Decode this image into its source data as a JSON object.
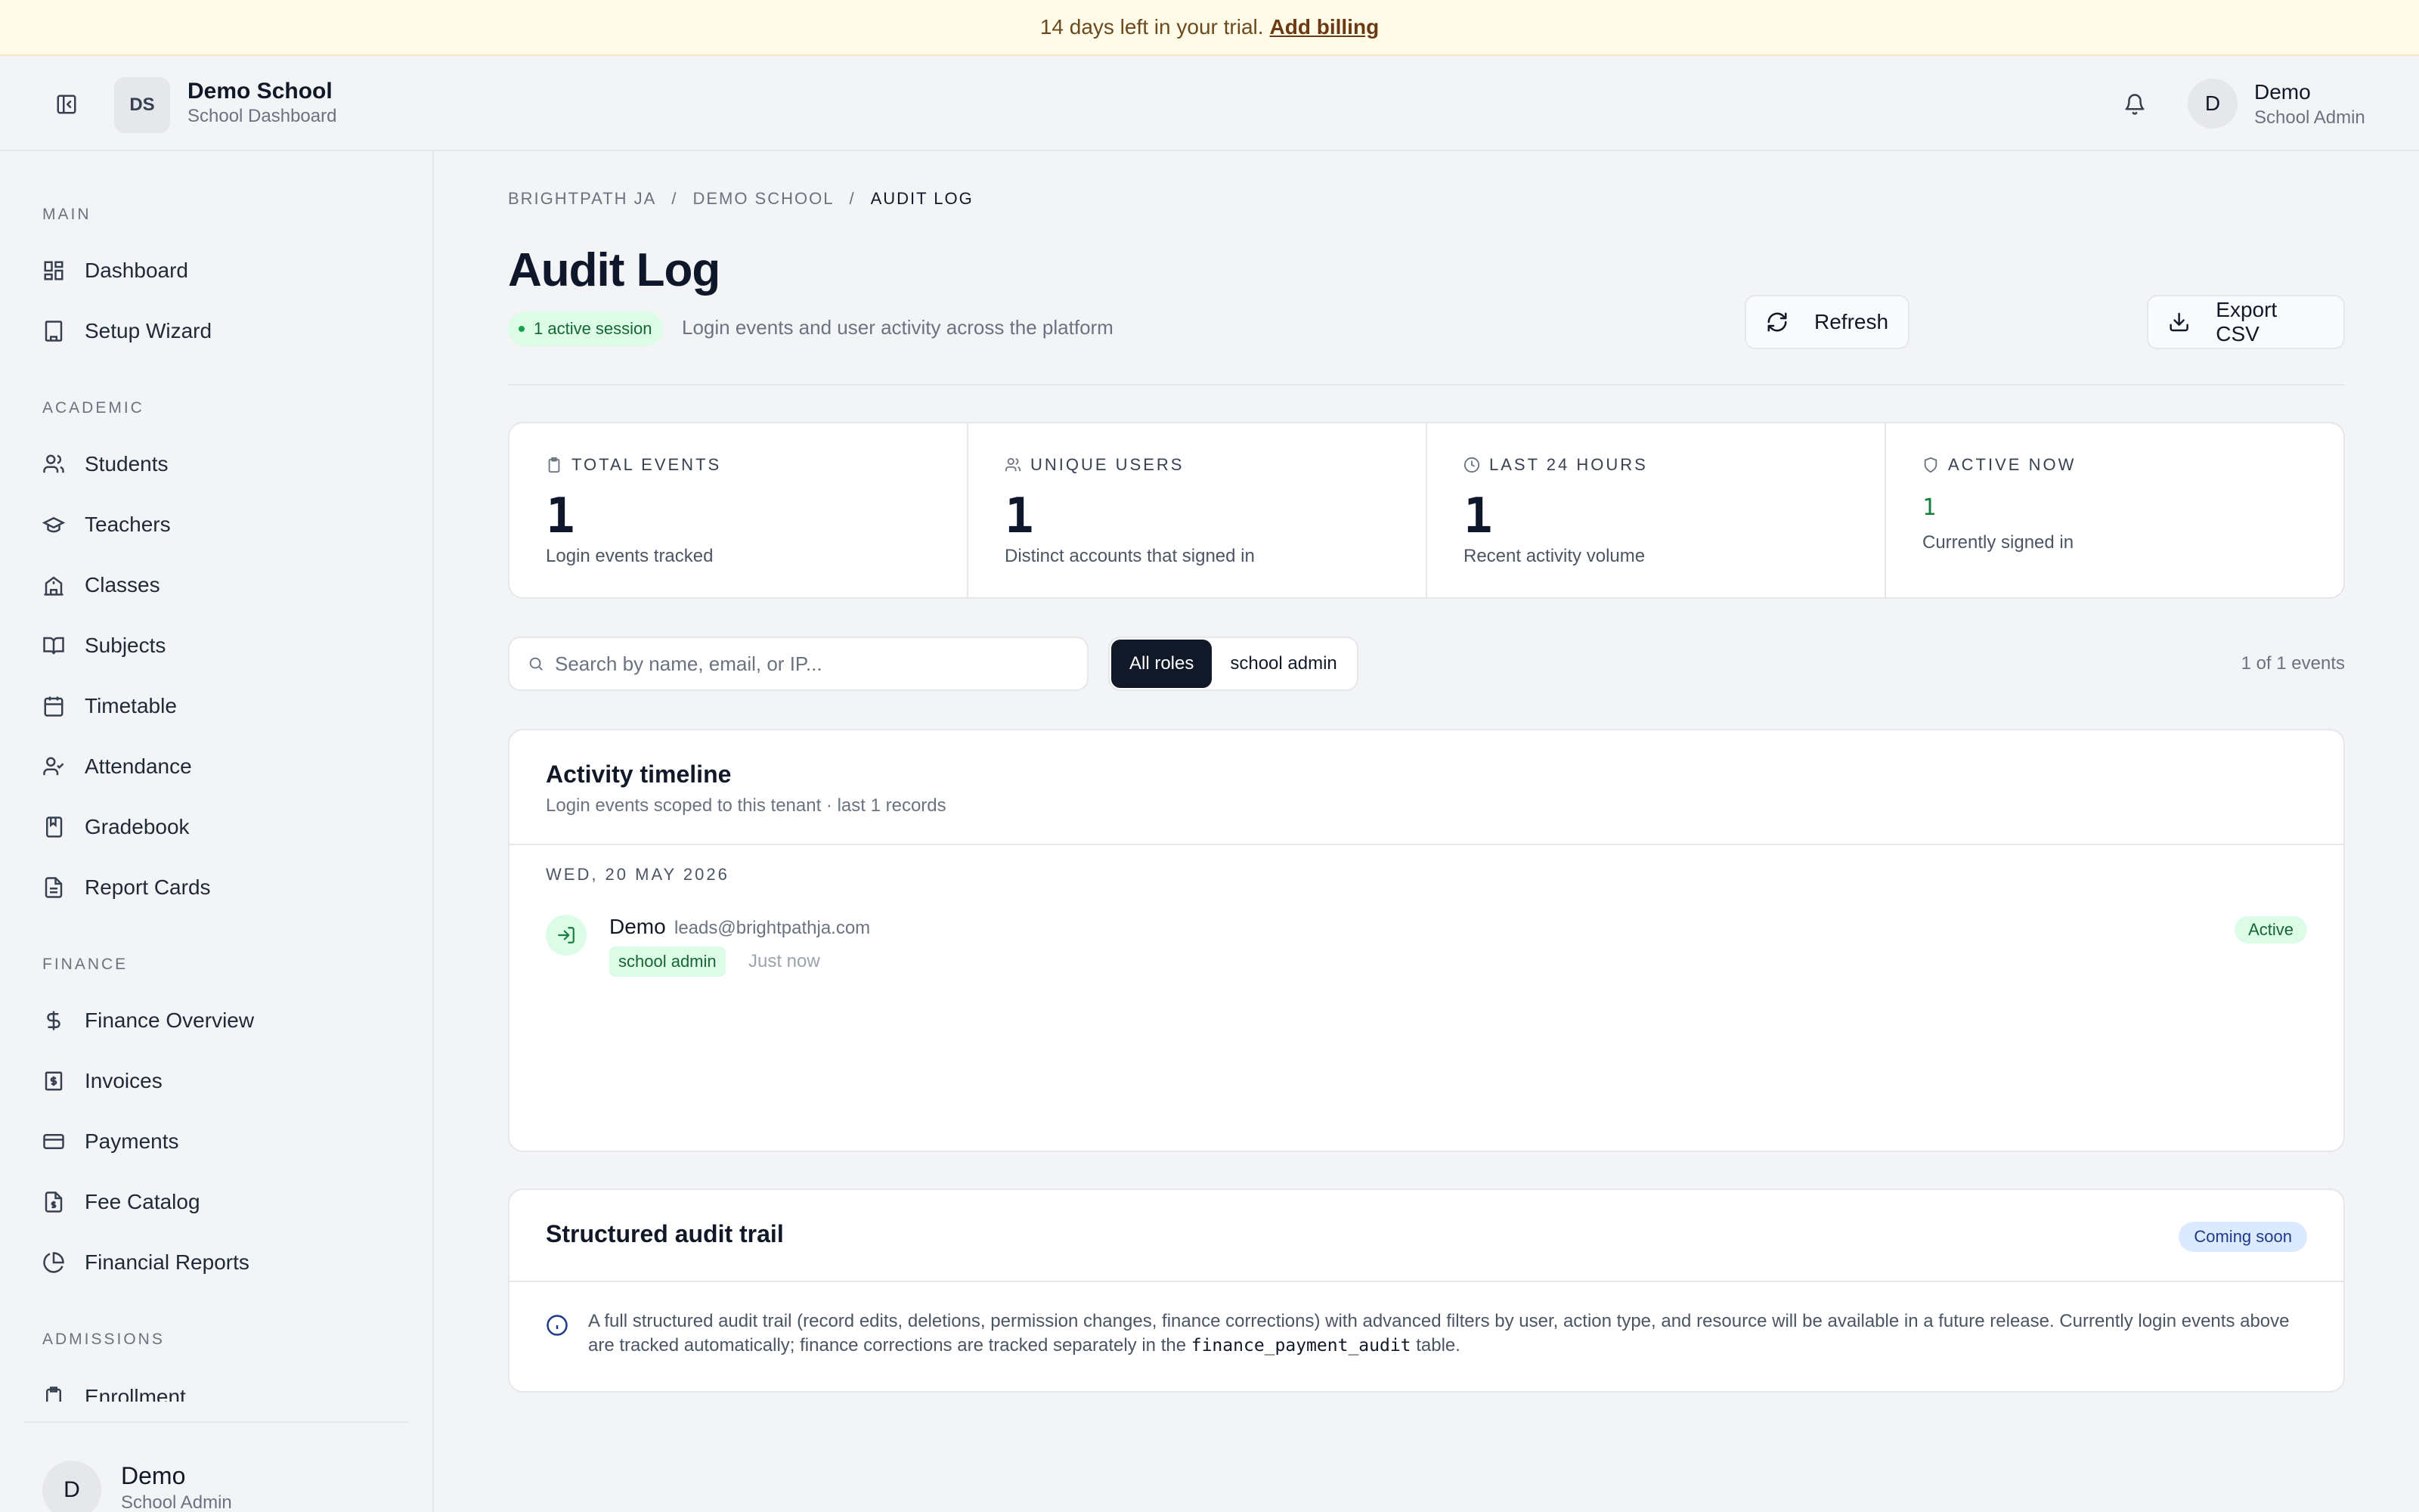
{
  "banner": {
    "text": "14 days left in your trial.",
    "link": "Add billing"
  },
  "topbar": {
    "school_initials": "DS",
    "school_name": "Demo School",
    "school_sub": "School Dashboard",
    "user_initial": "D",
    "user_name": "Demo",
    "user_role": "School Admin"
  },
  "sidebar": {
    "sections": {
      "main": "MAIN",
      "academic": "ACADEMIC",
      "finance": "FINANCE",
      "admissions": "ADMISSIONS"
    },
    "items": {
      "dashboard": "Dashboard",
      "setup_wizard": "Setup Wizard",
      "students": "Students",
      "teachers": "Teachers",
      "classes": "Classes",
      "subjects": "Subjects",
      "timetable": "Timetable",
      "attendance": "Attendance",
      "gradebook": "Gradebook",
      "report_cards": "Report Cards",
      "finance_overview": "Finance Overview",
      "invoices": "Invoices",
      "payments": "Payments",
      "fee_catalog": "Fee Catalog",
      "financial_reports": "Financial Reports",
      "enrollment": "Enrollment"
    },
    "footer": {
      "initial": "D",
      "name": "Demo",
      "role": "School Admin"
    }
  },
  "breadcrumb": [
    "BRIGHTPATH JA",
    "/",
    "DEMO SCHOOL",
    "/",
    "AUDIT LOG"
  ],
  "page": {
    "title": "Audit Log",
    "session_pill": "1 active session",
    "subtitle": "Login events and user activity across the platform",
    "refresh_label": "Refresh",
    "export_label": "Export CSV"
  },
  "stats": [
    {
      "label": "TOTAL EVENTS",
      "value": "1",
      "note": "Login events tracked",
      "icon": "clipboard-icon"
    },
    {
      "label": "UNIQUE USERS",
      "value": "1",
      "note": "Distinct accounts that signed in",
      "icon": "users-icon"
    },
    {
      "label": "LAST 24 HOURS",
      "value": "1",
      "note": "Recent activity volume",
      "icon": "clock-icon"
    },
    {
      "label": "ACTIVE NOW",
      "value": "1",
      "note": "Currently signed in",
      "icon": "shield-icon"
    }
  ],
  "filters": {
    "search_placeholder": "Search by name, email, or IP...",
    "roles": [
      "All roles",
      "school admin"
    ],
    "selected_role": "All roles",
    "count_text": "1 of 1 events"
  },
  "timeline": {
    "title": "Activity timeline",
    "subtitle": "Login events scoped to this tenant · last 1 records",
    "date": "WED, 20 MAY 2026",
    "event": {
      "name": "Demo",
      "email": "leads@brightpathja.com",
      "role": "school admin",
      "time": "Just now",
      "status": "Active"
    }
  },
  "audit_trail": {
    "title": "Structured audit trail",
    "badge": "Coming soon",
    "text_before": "A full structured audit trail (record edits, deletions, permission changes, finance corrections) with advanced filters by user, action type, and resource will be available in a future release. Currently login events above are tracked automatically; finance corrections are tracked separately in the",
    "code": "finance_payment_audit",
    "text_after": "table."
  },
  "colors": {
    "accent_green": "#16a34a",
    "dark": "#111827",
    "banner_bg": "#fefbe8"
  }
}
